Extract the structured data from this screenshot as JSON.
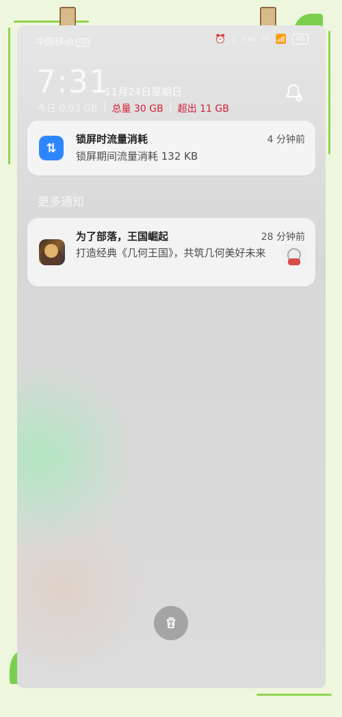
{
  "status": {
    "carrier": "中国移动",
    "hd_label": "HD",
    "speed_label": "0 K/s",
    "network": "5G",
    "battery": "46"
  },
  "lock": {
    "time": "7:31",
    "date": "11月24日星期日",
    "today_usage": "今日 0.93 GB",
    "total_usage": "总量 30 GB",
    "over_usage": "超出 11 GB"
  },
  "notifications": {
    "primary": {
      "title": "锁屏时流量消耗",
      "time": "4 分钟前",
      "body": "锁屏期间流量消耗 132 KB"
    },
    "more_label": "更多通知",
    "secondary": {
      "title": "为了部落，王国崛起",
      "time": "28 分钟前",
      "body": "打造经典《几何王国》，共筑几何美好未来"
    }
  },
  "icons": {
    "data_icon": "up-down-arrows-icon",
    "bell_icon": "bell-settings-icon",
    "trash_icon": "trash-icon"
  },
  "colors": {
    "accent_blue": "#2e86ff",
    "warning_red": "#d31c35"
  }
}
